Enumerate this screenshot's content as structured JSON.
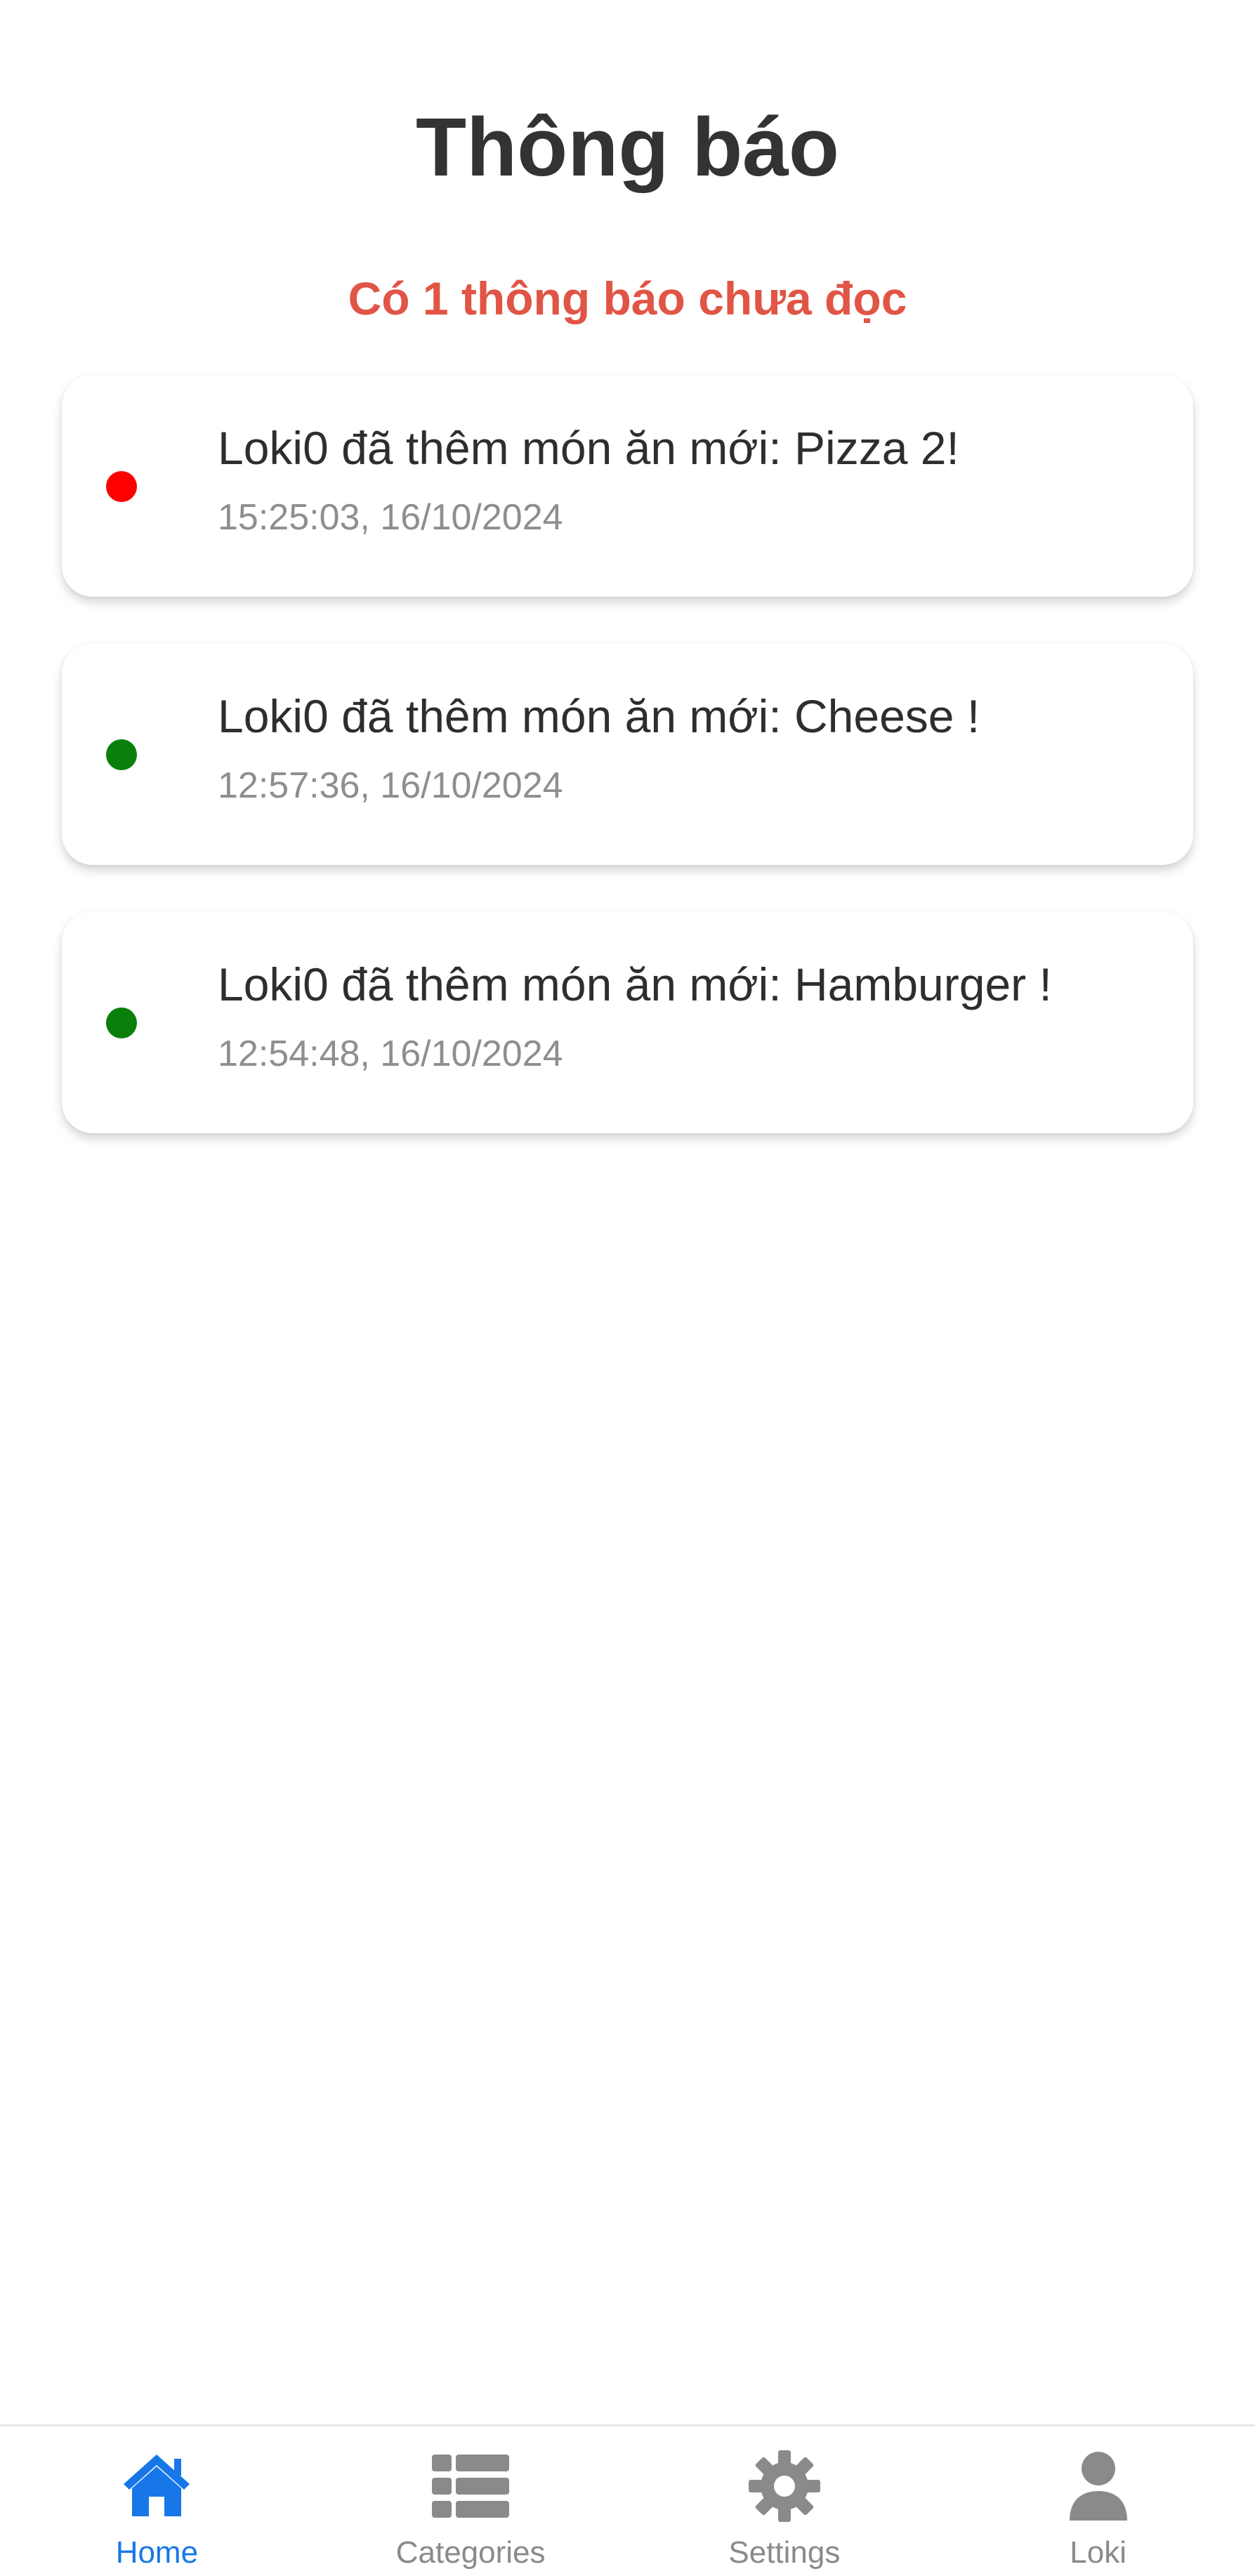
{
  "page": {
    "title": "Thông báo",
    "unread_text": "Có 1 thông báo chưa đọc"
  },
  "notifications": [
    {
      "message": "Loki0 đã thêm món ăn mới: Pizza 2!",
      "time": "15:25:03, 16/10/2024",
      "read": false,
      "dot_color": "#ff0000"
    },
    {
      "message": "Loki0 đã thêm món ăn mới: Cheese !",
      "time": "12:57:36, 16/10/2024",
      "read": true,
      "dot_color": "#0a7f0a"
    },
    {
      "message": "Loki0 đã thêm món ăn mới: Hamburger !",
      "time": "12:54:48, 16/10/2024",
      "read": true,
      "dot_color": "#0a7f0a"
    }
  ],
  "bottom_nav": {
    "items": [
      {
        "label": "Home",
        "icon": "home-icon",
        "active": true
      },
      {
        "label": "Categories",
        "icon": "list-icon",
        "active": false
      },
      {
        "label": "Settings",
        "icon": "gear-icon",
        "active": false
      },
      {
        "label": "Loki",
        "icon": "user-icon",
        "active": false
      }
    ]
  },
  "colors": {
    "accent": "#1877e8",
    "unread_text": "#e05546",
    "inactive_icon": "#8a8a8a",
    "unread_dot": "#ff0000",
    "read_dot": "#0a7f0a"
  }
}
